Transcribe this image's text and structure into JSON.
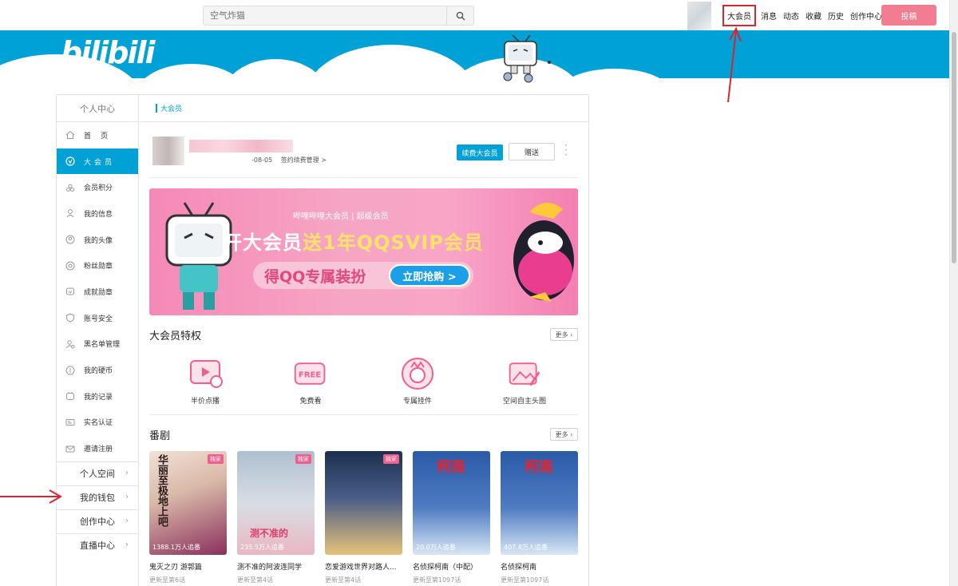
{
  "topbar": {
    "search_placeholder": "空气炸猫",
    "nav": [
      "大会员",
      "消息",
      "动态",
      "收藏",
      "历史",
      "创作中心"
    ],
    "post_label": "投稿"
  },
  "colors": {
    "brand_blue": "#00a1d6",
    "brand_pink": "#f25d8e",
    "post_pink": "#f27d93",
    "annotation_red": "#d7262f"
  },
  "banner": {
    "logo": "bilibili"
  },
  "sidebar": {
    "title": "个人中心",
    "items": [
      {
        "label": "首页",
        "icon": "home-icon"
      },
      {
        "label": "大会员",
        "icon": "vip-icon"
      },
      {
        "label": "会员积分",
        "icon": "points-icon"
      },
      {
        "label": "我的信息",
        "icon": "user-info-icon"
      },
      {
        "label": "我的头像",
        "icon": "avatar-icon"
      },
      {
        "label": "粉丝勋章",
        "icon": "medal-icon"
      },
      {
        "label": "成就勋章",
        "icon": "achievement-icon"
      },
      {
        "label": "账号安全",
        "icon": "shield-icon"
      },
      {
        "label": "黑名单管理",
        "icon": "blacklist-icon"
      },
      {
        "label": "我的硬币",
        "icon": "coin-icon"
      },
      {
        "label": "我的记录",
        "icon": "record-icon"
      },
      {
        "label": "实名认证",
        "icon": "id-card-icon"
      },
      {
        "label": "邀请注册",
        "icon": "invite-icon"
      }
    ],
    "groups": [
      "个人空间",
      "我的钱包",
      "创作中心",
      "直播中心"
    ]
  },
  "main": {
    "breadcrumb": "大会员",
    "user": {
      "expiry": "-08-05",
      "manage_link": "签约续费管理 >"
    },
    "renew_label": "续费大会员",
    "gift_label": "赠送",
    "ad": {
      "top": "哔哩哔哩大会员 | 超级会员",
      "main_1": "开大会员",
      "main_2": "送1年QQSVIP会员",
      "sub": "得QQ专属装扮",
      "buy": "立即抢购 >"
    },
    "privileges": {
      "title": "大会员特权",
      "more": "更多",
      "items": [
        {
          "label": "半价点播",
          "icon": "play-icon"
        },
        {
          "label": "免费看",
          "icon": "free-icon"
        },
        {
          "label": "专属挂件",
          "icon": "pendant-icon"
        },
        {
          "label": "空间自主头图",
          "icon": "image-edit-icon"
        }
      ]
    },
    "anime": {
      "title": "番剧",
      "more": "更多",
      "items": [
        {
          "title": "鬼灭之刃 游郭篇",
          "views": "1388.1万人追番",
          "updated": "更新至第6话",
          "badge": "独家",
          "poster_text": "华丽至极地上吧",
          "colors": [
            "#e8d2c2",
            "#8a2f5c"
          ]
        },
        {
          "title": "测不准的阿波连同学",
          "views": "235.5万人追番",
          "updated": "更新至第4话",
          "badge": "独家",
          "poster_text": "测不准的",
          "colors": [
            "#b9c9d8",
            "#e7b8c4"
          ]
        },
        {
          "title": "恋爱游戏世界对路人...",
          "views": "",
          "updated": "更新至第4话",
          "badge": "独家",
          "poster_text": "",
          "colors": [
            "#1c3050",
            "#e6c27a"
          ]
        },
        {
          "title": "名侦探柯南（中配）",
          "views": "20.0万人追番",
          "updated": "更新至第1097话",
          "badge": "",
          "poster_text": "柯南",
          "colors": [
            "#2a5aa8",
            "#d8e6f5"
          ]
        },
        {
          "title": "名侦探柯南",
          "views": "407.8万人追番",
          "updated": "更新至第1097话",
          "badge": "",
          "poster_text": "柯南",
          "colors": [
            "#2a5aa8",
            "#d8e6f5"
          ]
        }
      ]
    }
  }
}
